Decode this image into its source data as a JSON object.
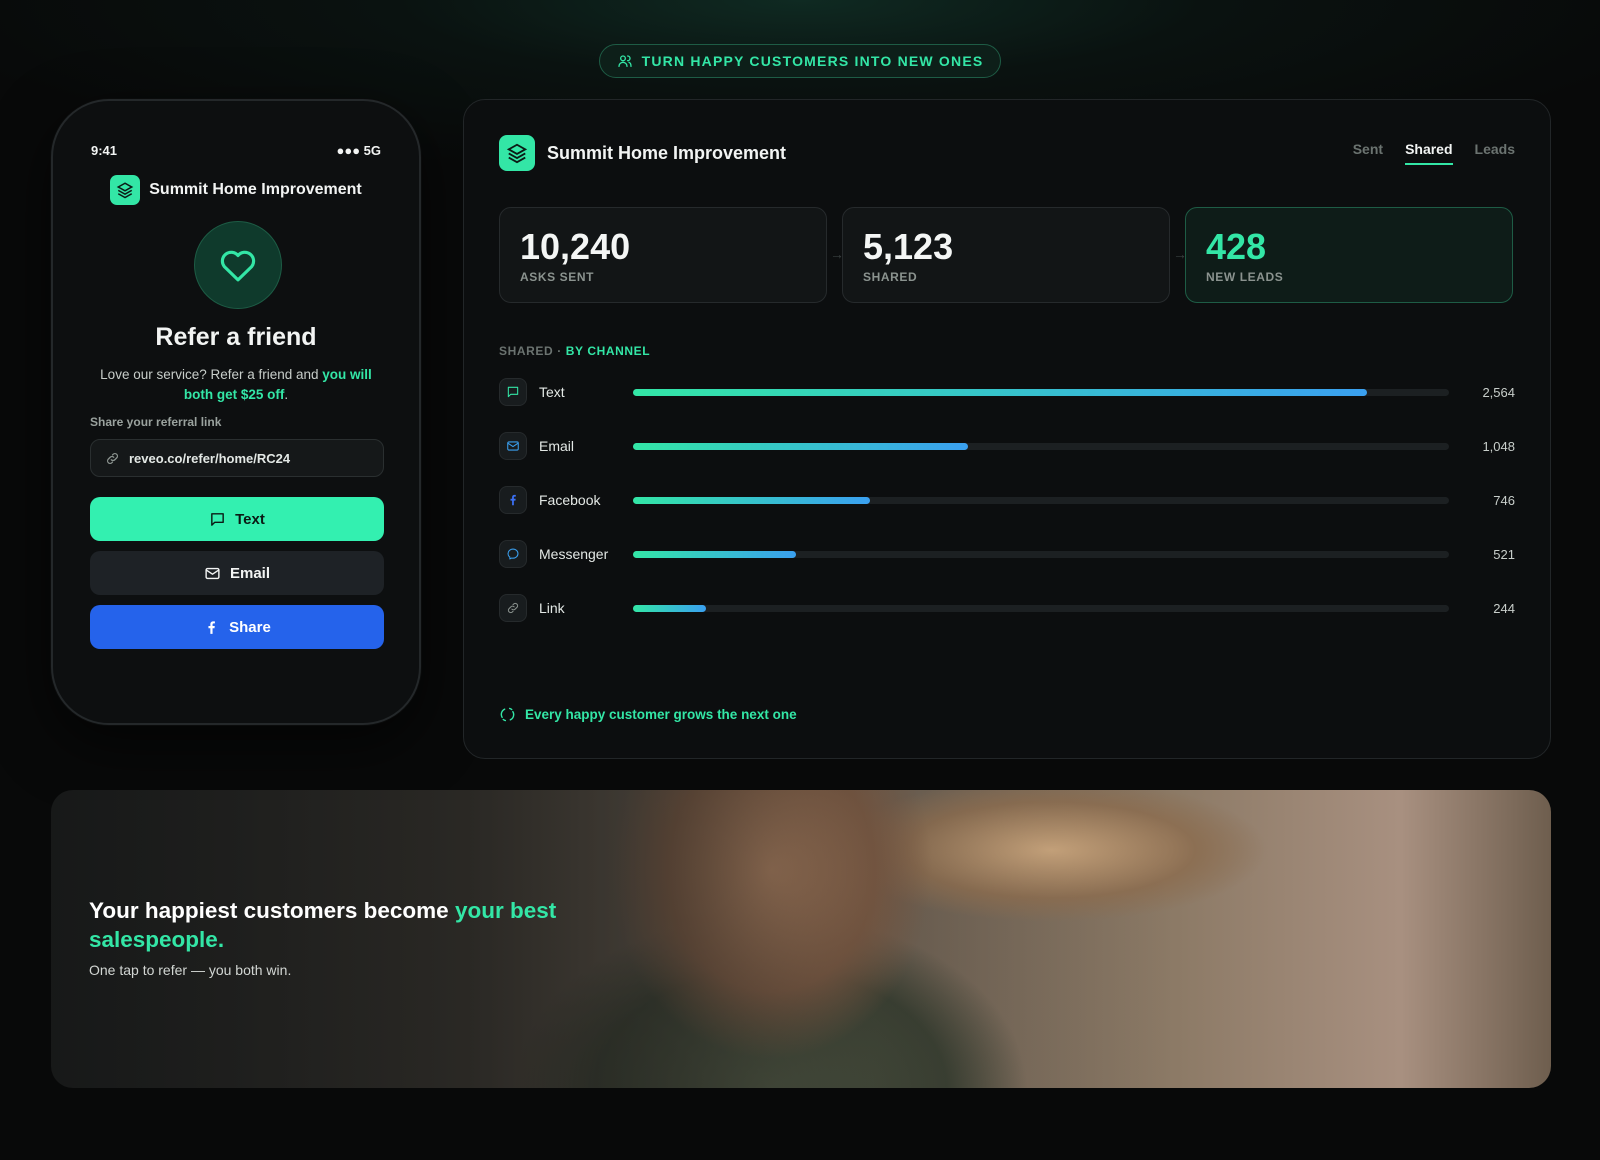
{
  "tagline": "TURN HAPPY CUSTOMERS INTO NEW ONES",
  "colors": {
    "accent": "#33e6a6",
    "facebook": "#2563eb",
    "bg": "#080909"
  },
  "phone": {
    "time": "9:41",
    "signal": "●●● 5G",
    "brand": "Summit Home Improvement",
    "title": "Refer a friend",
    "desc_prefix": "Love our service? Refer a friend and ",
    "desc_highlight": "you will both get $25 off",
    "desc_suffix": ".",
    "share_label": "Share your referral link",
    "referral_link": "reveo.co/refer/home/RC24",
    "buttons": {
      "text": "Text",
      "email": "Email",
      "share": "Share"
    }
  },
  "dashboard": {
    "brand": "Summit Home Improvement",
    "tabs": [
      {
        "label": "Sent",
        "active": false
      },
      {
        "label": "Shared",
        "active": true
      },
      {
        "label": "Leads",
        "active": false
      }
    ],
    "stats": [
      {
        "value": "10,240",
        "label": "ASKS SENT"
      },
      {
        "value": "5,123",
        "label": "SHARED"
      },
      {
        "value": "428",
        "label": "NEW LEADS"
      }
    ],
    "section_label": "SHARED",
    "section_sep": " · ",
    "section_highlight": "BY CHANNEL",
    "channels": [
      {
        "name": "Text",
        "value": "2,564",
        "fraction": 0.9,
        "icon": "chat-bubble-icon"
      },
      {
        "name": "Email",
        "value": "1,048",
        "fraction": 0.41,
        "icon": "mail-icon"
      },
      {
        "name": "Facebook",
        "value": "746",
        "fraction": 0.29,
        "icon": "facebook-icon"
      },
      {
        "name": "Messenger",
        "value": "521",
        "fraction": 0.2,
        "icon": "messenger-icon"
      },
      {
        "name": "Link",
        "value": "244",
        "fraction": 0.09,
        "icon": "link-icon"
      }
    ],
    "footer_note": "Every happy customer grows the next one"
  },
  "banner": {
    "headline_prefix": "Your happiest customers become ",
    "headline_highlight": "your best salespeople.",
    "subline": "One tap to refer — you both win."
  }
}
